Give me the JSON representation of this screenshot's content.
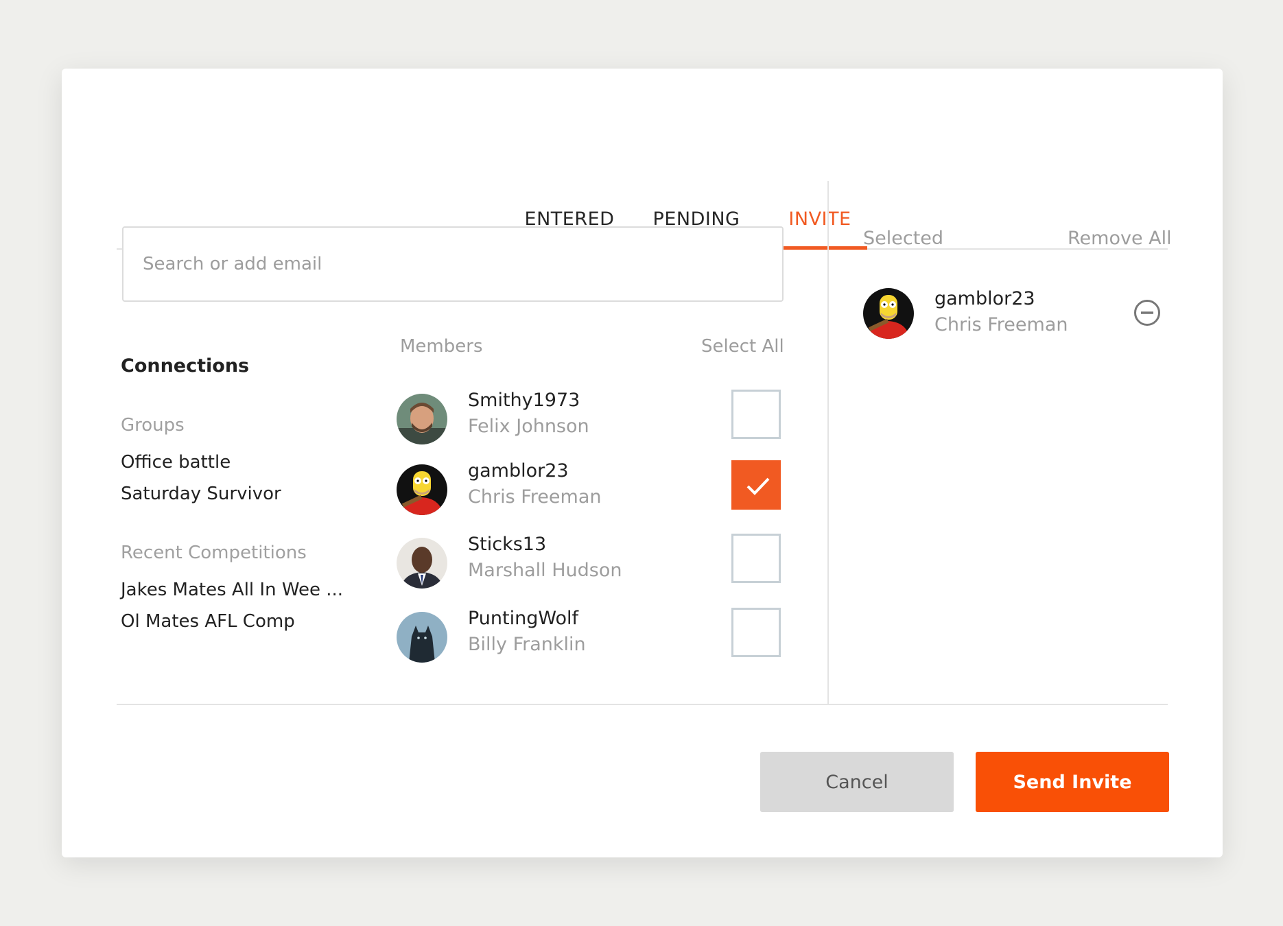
{
  "tabs": [
    {
      "label": "ENTERED",
      "active": false
    },
    {
      "label": "PENDING",
      "active": false
    },
    {
      "label": "INVITE",
      "active": true
    }
  ],
  "search": {
    "placeholder": "Search or add email",
    "value": ""
  },
  "connections": {
    "title": "Connections",
    "groups_label": "Groups",
    "groups": [
      "Office battle",
      "Saturday Survivor"
    ],
    "recent_label": "Recent Competitions",
    "recent": [
      "Jakes Mates All In Wee ...",
      "Ol Mates AFL Comp"
    ]
  },
  "members": {
    "label": "Members",
    "select_all_label": "Select All",
    "items": [
      {
        "username": "Smithy1973",
        "name": "Felix Johnson",
        "checked": false,
        "avatar": "man-beard-photo"
      },
      {
        "username": "gamblor23",
        "name": "Chris Freeman",
        "checked": true,
        "avatar": "cartoon-character"
      },
      {
        "username": "Sticks13",
        "name": "Marshall Hudson",
        "checked": false,
        "avatar": "man-suit-photo"
      },
      {
        "username": "PuntingWolf",
        "name": "Billy Franklin",
        "checked": false,
        "avatar": "wolf-photo"
      }
    ]
  },
  "selected_panel": {
    "label": "Selected",
    "remove_all_label": "Remove All",
    "items": [
      {
        "username": "gamblor23",
        "name": "Chris Freeman",
        "avatar": "cartoon-character"
      }
    ]
  },
  "buttons": {
    "cancel": "Cancel",
    "send": "Send Invite"
  },
  "colors": {
    "accent": "#f15a22",
    "send_button": "#f95006",
    "muted_text": "#9d9d9d"
  }
}
